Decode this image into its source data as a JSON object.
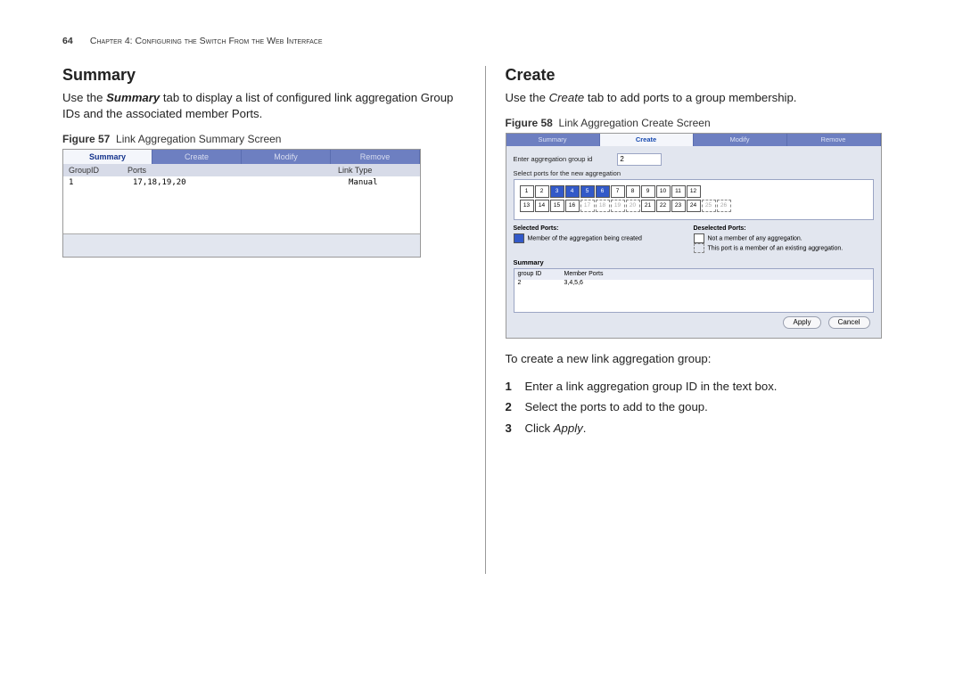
{
  "page_number": "64",
  "chapter_header": "Chapter 4: Configuring the Switch From the Web Interface",
  "left": {
    "heading": "Summary",
    "body_pre": "Use the ",
    "body_em": "Summary",
    "body_post": " tab to display a list of configured link aggregation Group IDs and the associated member Ports.",
    "fig_label": "Figure 57",
    "fig_title": "Link Aggregation Summary Screen",
    "tabs": [
      "Summary",
      "Create",
      "Modify",
      "Remove"
    ],
    "columns": [
      "GroupID",
      "Ports",
      "Link Type"
    ],
    "row": {
      "group_id": "1",
      "ports": "17,18,19,20",
      "link_type": "Manual"
    }
  },
  "right": {
    "heading": "Create",
    "body_pre": "Use the ",
    "body_em": "Create",
    "body_post": " tab to add ports to a group membership.",
    "fig_label": "Figure 58",
    "fig_title": "Link Aggregation Create Screen",
    "tabs": [
      "Summary",
      "Create",
      "Modify",
      "Remove"
    ],
    "enter_label": "Enter aggregation group id",
    "group_id_value": "2",
    "select_label": "Select ports for the new aggregation",
    "ports_top": [
      {
        "n": "1",
        "s": false
      },
      {
        "n": "2",
        "s": false
      },
      {
        "n": "3",
        "s": true
      },
      {
        "n": "4",
        "s": true
      },
      {
        "n": "5",
        "s": true
      },
      {
        "n": "6",
        "s": true
      },
      {
        "n": "7",
        "s": false
      },
      {
        "n": "8",
        "s": false
      },
      {
        "n": "9",
        "s": false
      },
      {
        "n": "10",
        "s": false
      },
      {
        "n": "11",
        "s": false
      },
      {
        "n": "12",
        "s": false
      }
    ],
    "ports_bottom": [
      {
        "n": "13",
        "s": false
      },
      {
        "n": "14",
        "s": false
      },
      {
        "n": "15",
        "s": false
      },
      {
        "n": "16",
        "s": false
      },
      {
        "n": "17",
        "d": true
      },
      {
        "n": "18",
        "d": true
      },
      {
        "n": "19",
        "d": true
      },
      {
        "n": "20",
        "d": true
      },
      {
        "n": "21",
        "s": false
      },
      {
        "n": "22",
        "s": false
      },
      {
        "n": "23",
        "s": false
      },
      {
        "n": "24",
        "s": false
      },
      {
        "n": "25",
        "d": true
      },
      {
        "n": "26",
        "d": true
      }
    ],
    "legend_selected_hdr": "Selected Ports:",
    "legend_selected_item": "Member of the aggregation being created",
    "legend_deselected_hdr": "Deselected Ports:",
    "legend_deselected_item1": "Not a member of any aggregation.",
    "legend_deselected_item2": "This port is a member of an existing aggregation.",
    "summary_hdr": "Summary",
    "summary_cols": [
      "group ID",
      "Member Ports"
    ],
    "summary_row": {
      "gid": "2",
      "members": "3,4,5,6"
    },
    "apply_btn": "Apply",
    "cancel_btn": "Cancel",
    "intro_line": "To create a new link aggregation group:",
    "steps": [
      "Enter a link aggregation group ID in the text box.",
      "Select the ports to add to the goup.",
      {
        "pre": "Click ",
        "em": "Apply",
        "post": "."
      }
    ]
  }
}
